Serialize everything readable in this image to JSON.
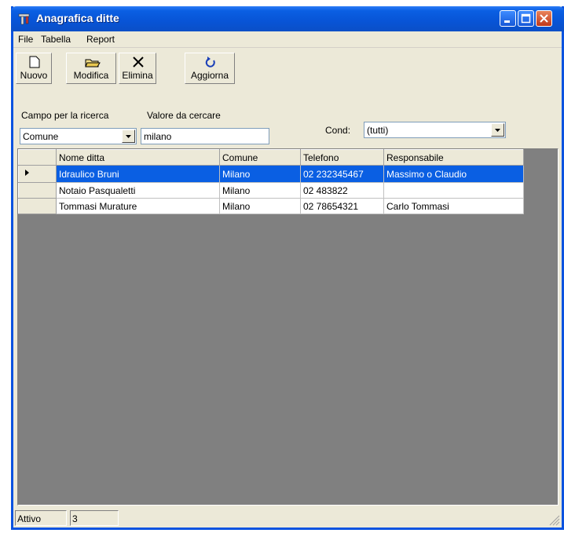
{
  "window": {
    "title": "Anagrafica ditte"
  },
  "menu": [
    "File",
    "Tabella",
    "Report"
  ],
  "toolbar": {
    "new_label": "Nuovo",
    "edit_label": "Modifica",
    "delete_label": "Elimina",
    "refresh_label": "Aggiorna"
  },
  "search": {
    "field_label": "Campo per la ricerca",
    "field_value": "Comune",
    "value_label": "Valore da cercare",
    "value_text": "milano",
    "cond_label": "Cond:",
    "cond_value": "(tutti)"
  },
  "grid": {
    "columns": [
      "Nome ditta",
      "Comune",
      "Telefono",
      "Responsabile"
    ],
    "rows": [
      [
        "Idraulico Bruni",
        "Milano",
        "02 232345467",
        "Massimo o Claudio"
      ],
      [
        "Notaio Pasqualetti",
        "Milano",
        "02 483822",
        ""
      ],
      [
        "Tommasi Murature",
        "Milano",
        "02 78654321",
        "Carlo Tommasi"
      ]
    ],
    "selected_row": 0
  },
  "status": {
    "state": "Attivo",
    "count": "3"
  },
  "colors": {
    "title_blue": "#0a5fe3",
    "selection": "#0a5fe3",
    "grid_bg": "#808080"
  }
}
